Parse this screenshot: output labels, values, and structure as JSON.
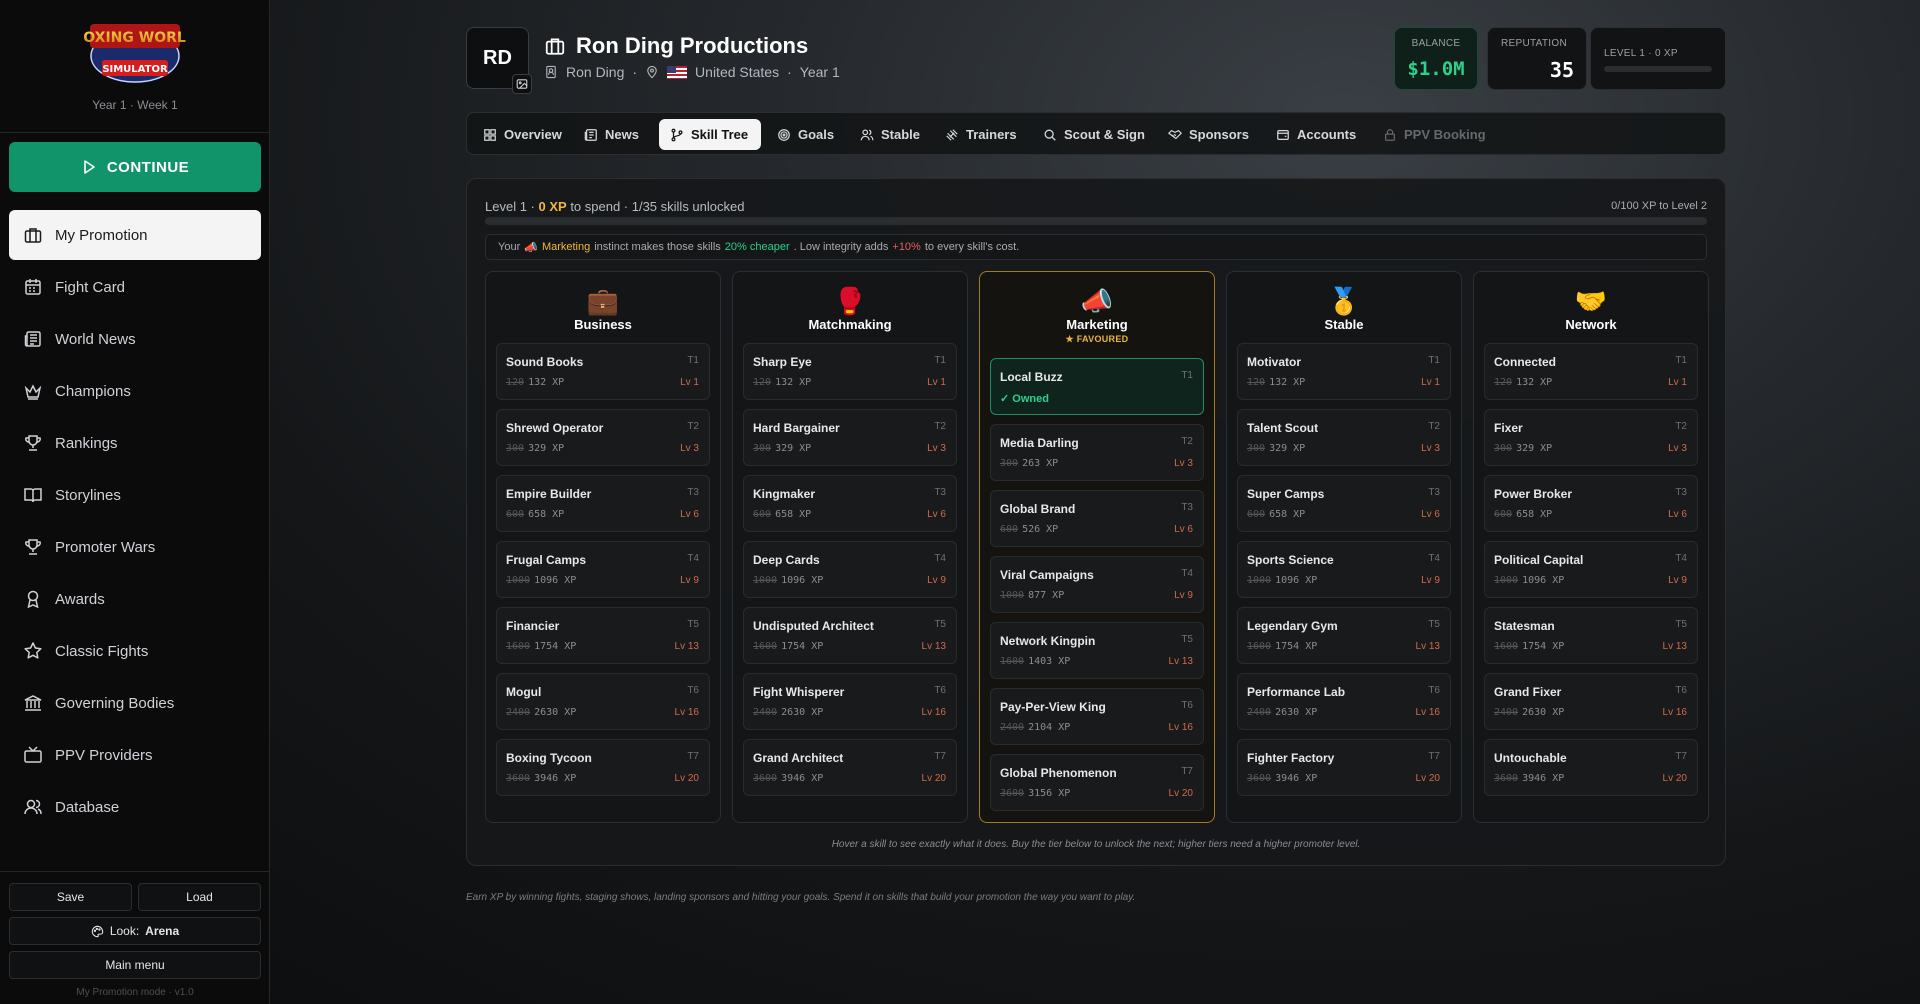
{
  "sidebar": {
    "logo_text": "BOXING WORLD SIMULATOR",
    "week": "Year 1 · Week 1",
    "continue_label": "CONTINUE",
    "items": [
      {
        "label": "My Promotion",
        "icon": "briefcase-icon"
      },
      {
        "label": "Fight Card",
        "icon": "calendar-icon"
      },
      {
        "label": "World News",
        "icon": "newspaper-icon"
      },
      {
        "label": "Champions",
        "icon": "crown-icon"
      },
      {
        "label": "Rankings",
        "icon": "trophy-icon"
      },
      {
        "label": "Storylines",
        "icon": "book-icon"
      },
      {
        "label": "Promoter Wars",
        "icon": "trophy-icon"
      },
      {
        "label": "Awards",
        "icon": "award-icon"
      },
      {
        "label": "Classic Fights",
        "icon": "star-icon"
      },
      {
        "label": "Governing Bodies",
        "icon": "bank-icon"
      },
      {
        "label": "PPV Providers",
        "icon": "tv-icon"
      },
      {
        "label": "Database",
        "icon": "users-icon"
      }
    ],
    "save_label": "Save",
    "load_label": "Load",
    "look_label": "Look:",
    "look_value": "Arena",
    "main_menu_label": "Main menu",
    "mode_text": "My Promotion mode · v1.0"
  },
  "header": {
    "initials": "RD",
    "title": "Ron Ding Productions",
    "owner": "Ron Ding",
    "country": "United States",
    "year": "Year 1",
    "balance_label": "BALANCE",
    "balance_value": "$1.0M",
    "reputation_label": "REPUTATION",
    "reputation_value": "35",
    "level_label": "LEVEL 1 · 0 XP",
    "level_progress": 0
  },
  "tabs": [
    {
      "label": "Overview",
      "icon": "grid-icon"
    },
    {
      "label": "News",
      "icon": "newspaper-icon"
    },
    {
      "label": "Skill Tree",
      "icon": "branch-icon"
    },
    {
      "label": "Goals",
      "icon": "target-icon"
    },
    {
      "label": "Stable",
      "icon": "users-icon"
    },
    {
      "label": "Trainers",
      "icon": "dumbbell-icon"
    },
    {
      "label": "Scout & Sign",
      "icon": "search-icon"
    },
    {
      "label": "Sponsors",
      "icon": "shield-icon"
    },
    {
      "label": "Accounts",
      "icon": "wallet-icon"
    },
    {
      "label": "PPV Booking",
      "icon": "lock-icon"
    }
  ],
  "skilltree": {
    "level_prefix": "Level 1 ·",
    "xp_value": "0 XP",
    "level_suffix": "to spend · 1/35 skills unlocked",
    "progress_text": "0/100 XP to Level 2",
    "progress": 0,
    "tip_prefix": "Your",
    "tip_emoji": "📣",
    "tip_skill": "Marketing",
    "tip_mid": "instinct makes those skills",
    "tip_discount": "20% cheaper",
    "tip_mid2": ". Low integrity adds",
    "tip_penalty": "+10%",
    "tip_end": "to every skill's cost.",
    "hint": "Hover a skill to see exactly what it does. Buy the tier below to unlock the next; higher tiers need a higher promoter level.",
    "footer": "Earn XP by winning fights, staging shows, landing sponsors and hitting your goals. Spend it on skills that build your promotion the way you want to play.",
    "columns": [
      {
        "title": "Business",
        "emoji": "💼",
        "favoured": "",
        "skills": [
          {
            "name": "Sound Books",
            "tier": "T1",
            "old": "120",
            "cost": "132 XP",
            "lv": "Lv 1"
          },
          {
            "name": "Shrewd Operator",
            "tier": "T2",
            "old": "300",
            "cost": "329 XP",
            "lv": "Lv 3"
          },
          {
            "name": "Empire Builder",
            "tier": "T3",
            "old": "600",
            "cost": "658 XP",
            "lv": "Lv 6"
          },
          {
            "name": "Frugal Camps",
            "tier": "T4",
            "old": "1000",
            "cost": "1096 XP",
            "lv": "Lv 9"
          },
          {
            "name": "Financier",
            "tier": "T5",
            "old": "1600",
            "cost": "1754 XP",
            "lv": "Lv 13"
          },
          {
            "name": "Mogul",
            "tier": "T6",
            "old": "2400",
            "cost": "2630 XP",
            "lv": "Lv 16"
          },
          {
            "name": "Boxing Tycoon",
            "tier": "T7",
            "old": "3600",
            "cost": "3946 XP",
            "lv": "Lv 20"
          }
        ]
      },
      {
        "title": "Matchmaking",
        "emoji": "🥊",
        "favoured": "",
        "skills": [
          {
            "name": "Sharp Eye",
            "tier": "T1",
            "old": "120",
            "cost": "132 XP",
            "lv": "Lv 1"
          },
          {
            "name": "Hard Bargainer",
            "tier": "T2",
            "old": "300",
            "cost": "329 XP",
            "lv": "Lv 3"
          },
          {
            "name": "Kingmaker",
            "tier": "T3",
            "old": "600",
            "cost": "658 XP",
            "lv": "Lv 6"
          },
          {
            "name": "Deep Cards",
            "tier": "T4",
            "old": "1000",
            "cost": "1096 XP",
            "lv": "Lv 9"
          },
          {
            "name": "Undisputed Architect",
            "tier": "T5",
            "old": "1600",
            "cost": "1754 XP",
            "lv": "Lv 13"
          },
          {
            "name": "Fight Whisperer",
            "tier": "T6",
            "old": "2400",
            "cost": "2630 XP",
            "lv": "Lv 16"
          },
          {
            "name": "Grand Architect",
            "tier": "T7",
            "old": "3600",
            "cost": "3946 XP",
            "lv": "Lv 20"
          }
        ]
      },
      {
        "title": "Marketing",
        "emoji": "📣",
        "favoured": "★ FAVOURED",
        "skills": [
          {
            "name": "Local Buzz",
            "tier": "T1",
            "owned": "✓ Owned"
          },
          {
            "name": "Media Darling",
            "tier": "T2",
            "old": "300",
            "cost": "263 XP",
            "lv": "Lv 3"
          },
          {
            "name": "Global Brand",
            "tier": "T3",
            "old": "600",
            "cost": "526 XP",
            "lv": "Lv 6"
          },
          {
            "name": "Viral Campaigns",
            "tier": "T4",
            "old": "1000",
            "cost": "877 XP",
            "lv": "Lv 9"
          },
          {
            "name": "Network Kingpin",
            "tier": "T5",
            "old": "1600",
            "cost": "1403 XP",
            "lv": "Lv 13"
          },
          {
            "name": "Pay-Per-View King",
            "tier": "T6",
            "old": "2400",
            "cost": "2104 XP",
            "lv": "Lv 16"
          },
          {
            "name": "Global Phenomenon",
            "tier": "T7",
            "old": "3600",
            "cost": "3156 XP",
            "lv": "Lv 20"
          }
        ]
      },
      {
        "title": "Stable",
        "emoji": "🥇",
        "favoured": "",
        "skills": [
          {
            "name": "Motivator",
            "tier": "T1",
            "old": "120",
            "cost": "132 XP",
            "lv": "Lv 1"
          },
          {
            "name": "Talent Scout",
            "tier": "T2",
            "old": "300",
            "cost": "329 XP",
            "lv": "Lv 3"
          },
          {
            "name": "Super Camps",
            "tier": "T3",
            "old": "600",
            "cost": "658 XP",
            "lv": "Lv 6"
          },
          {
            "name": "Sports Science",
            "tier": "T4",
            "old": "1000",
            "cost": "1096 XP",
            "lv": "Lv 9"
          },
          {
            "name": "Legendary Gym",
            "tier": "T5",
            "old": "1600",
            "cost": "1754 XP",
            "lv": "Lv 13"
          },
          {
            "name": "Performance Lab",
            "tier": "T6",
            "old": "2400",
            "cost": "2630 XP",
            "lv": "Lv 16"
          },
          {
            "name": "Fighter Factory",
            "tier": "T7",
            "old": "3600",
            "cost": "3946 XP",
            "lv": "Lv 20"
          }
        ]
      },
      {
        "title": "Network",
        "emoji": "🤝",
        "favoured": "",
        "skills": [
          {
            "name": "Connected",
            "tier": "T1",
            "old": "120",
            "cost": "132 XP",
            "lv": "Lv 1"
          },
          {
            "name": "Fixer",
            "tier": "T2",
            "old": "300",
            "cost": "329 XP",
            "lv": "Lv 3"
          },
          {
            "name": "Power Broker",
            "tier": "T3",
            "old": "600",
            "cost": "658 XP",
            "lv": "Lv 6"
          },
          {
            "name": "Political Capital",
            "tier": "T4",
            "old": "1000",
            "cost": "1096 XP",
            "lv": "Lv 9"
          },
          {
            "name": "Statesman",
            "tier": "T5",
            "old": "1600",
            "cost": "1754 XP",
            "lv": "Lv 13"
          },
          {
            "name": "Grand Fixer",
            "tier": "T6",
            "old": "2400",
            "cost": "2630 XP",
            "lv": "Lv 16"
          },
          {
            "name": "Untouchable",
            "tier": "T7",
            "old": "3600",
            "cost": "3946 XP",
            "lv": "Lv 20"
          }
        ]
      }
    ]
  },
  "colors": {
    "accent": "#12946a",
    "xp": "#f0b840",
    "favoured": "#e9b53b",
    "owned": "#2fd08a"
  }
}
